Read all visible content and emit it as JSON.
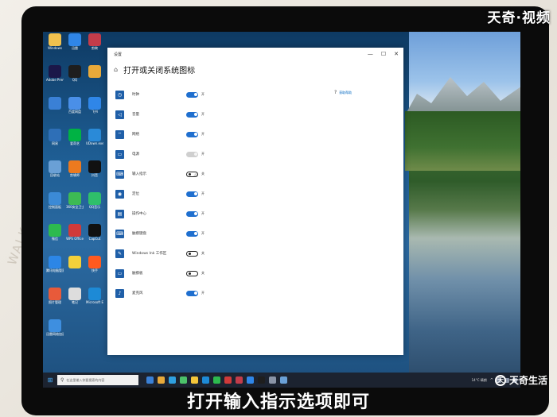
{
  "watermark": "天奇·视频",
  "brand": "天奇生活",
  "caption": "打开输入指示选项即可",
  "background_text": "WALK SCAPE 2020 MOSCE",
  "desktop_icons": [
    {
      "label": "Windows",
      "color": "#f1c14e"
    },
    {
      "label": "迅雷",
      "color": "#2f86e8"
    },
    {
      "label": "剪映",
      "color": "#c33c4a"
    },
    {
      "label": "Adobe Premie...",
      "color": "#1b1749"
    },
    {
      "label": "QQ",
      "color": "#1e1e1e"
    },
    {
      "label": "",
      "color": "#e8a93a"
    },
    {
      "label": "",
      "color": "#3a80d6"
    },
    {
      "label": "百度网盘",
      "color": "#4a8fe8"
    },
    {
      "label": "飞书",
      "color": "#2f86e8"
    },
    {
      "label": "网易",
      "color": "#2e6fb7"
    },
    {
      "label": "爱奇艺",
      "color": "#00b244"
    },
    {
      "label": "UDown.exe",
      "color": "#2a8ad8"
    },
    {
      "label": "回收站",
      "color": "#6aa0d6"
    },
    {
      "label": "剪辑师",
      "color": "#ec7a1f"
    },
    {
      "label": "抖音",
      "color": "#111111"
    },
    {
      "label": "控制面板",
      "color": "#3b8ad6"
    },
    {
      "label": "360安全卫士",
      "color": "#3dba54"
    },
    {
      "label": "QQ音乐",
      "color": "#2fbf6a"
    },
    {
      "label": "微信",
      "color": "#2dba4e"
    },
    {
      "label": "WPS Office",
      "color": "#d03a3a"
    },
    {
      "label": "CapCut",
      "color": "#111111"
    },
    {
      "label": "腾讯电脑管家",
      "color": "#2c86e6"
    },
    {
      "label": "",
      "color": "#f2d03a"
    },
    {
      "label": "快手",
      "color": "#ff5a1f"
    },
    {
      "label": "照片管理",
      "color": "#e85a3a"
    },
    {
      "label": "笔记",
      "color": "#ddd"
    },
    {
      "label": "Microsoft Edge",
      "color": "#1d8ad6"
    },
    {
      "label": "迅雷网络加速器",
      "color": "#3e8fe0"
    }
  ],
  "window": {
    "title": "设置",
    "controls": {
      "minimize": "—",
      "maximize": "☐",
      "close": "✕"
    },
    "home_icon": "⌂",
    "page_title": "打开或关闭系统图标",
    "help_link": "获取帮助",
    "rows": [
      {
        "label": "时钟",
        "state": "开",
        "toggle": "on",
        "icon": "◷"
      },
      {
        "label": "音量",
        "state": "开",
        "toggle": "on",
        "icon": "◁"
      },
      {
        "label": "网络",
        "state": "开",
        "toggle": "on",
        "icon": "⌔"
      },
      {
        "label": "电源",
        "state": "开",
        "toggle": "disabled",
        "icon": "▭"
      },
      {
        "label": "输入指示",
        "state": "关",
        "toggle": "off",
        "icon": "⌨"
      },
      {
        "label": "定位",
        "state": "开",
        "toggle": "on",
        "icon": "◉"
      },
      {
        "label": "操作中心",
        "state": "开",
        "toggle": "on",
        "icon": "▤"
      },
      {
        "label": "触摸键盘",
        "state": "开",
        "toggle": "on",
        "icon": "⌨"
      },
      {
        "label": "Windows Ink 工作区",
        "state": "关",
        "toggle": "off",
        "icon": "✎"
      },
      {
        "label": "触摸板",
        "state": "关",
        "toggle": "off",
        "icon": "▭"
      },
      {
        "label": "麦克风",
        "state": "开",
        "toggle": "on",
        "icon": "♪"
      }
    ]
  },
  "taskbar": {
    "search_placeholder": "在这里输入你要搜索的内容",
    "weather": "14°C 晴朗",
    "app_colors": [
      "#3a80d6",
      "#e8a93a",
      "#2fa0e0",
      "#4cc26a",
      "#f2c53a",
      "#1d8ad6",
      "#2dba4e",
      "#d03a3a",
      "#c33c4a",
      "#2f86e8",
      "#1e1e1e",
      "#8a94a6",
      "#6aa0d6"
    ]
  }
}
